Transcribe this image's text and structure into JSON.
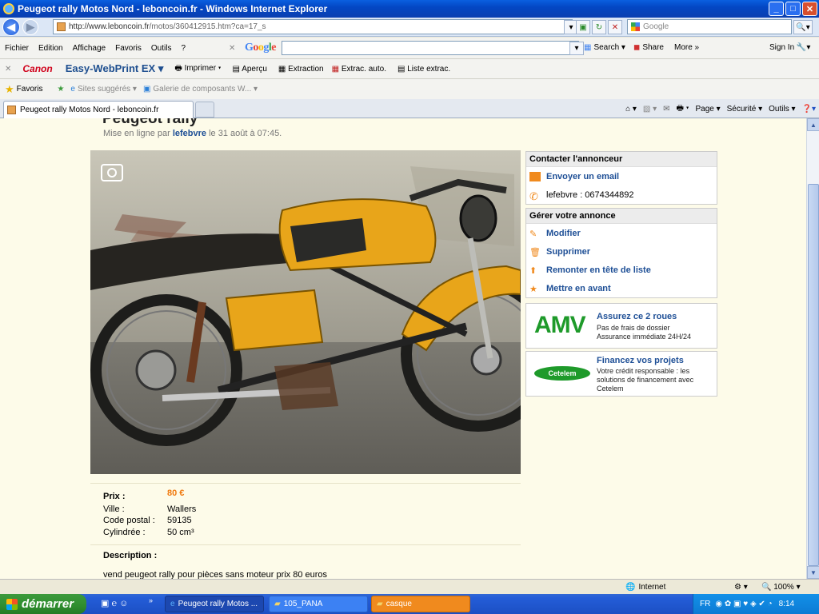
{
  "window": {
    "title": "Peugeot rally Motos Nord - leboncoin.fr - Windows Internet Explorer"
  },
  "address": {
    "url_host": "http://www.leboncoin.fr",
    "url_path": "/motos/360412915.htm?ca=17_s",
    "search_placeholder": "Google"
  },
  "menu": {
    "items": [
      "Fichier",
      "Edition",
      "Affichage",
      "Favoris",
      "Outils",
      "?"
    ],
    "google_label": "Google",
    "search": "Search",
    "share": "Share",
    "more": "More »",
    "signin": "Sign In"
  },
  "canonbar": {
    "canon": "Canon",
    "ewp": "Easy-WebPrint EX",
    "imprimer": "Imprimer",
    "apercu": "Aperçu",
    "extraction": "Extraction",
    "extrac_auto": "Extrac. auto.",
    "liste": "Liste extrac."
  },
  "favbar": {
    "favoris": "Favoris",
    "sites": "Sites suggérés",
    "galerie": "Galerie de composants W..."
  },
  "tabs": {
    "active": "Peugeot rally Motos Nord - leboncoin.fr",
    "page": "Page",
    "securite": "Sécurité",
    "outils": "Outils"
  },
  "ad": {
    "title": "Peugeot rally",
    "posted_prefix": "Mise en ligne par",
    "author": "lefebvre",
    "posted_suffix": "le 31 août à 07:45."
  },
  "contact": {
    "header": "Contacter l'annonceur",
    "email": "Envoyer un email",
    "phone": "lefebvre : 0674344892"
  },
  "manage": {
    "header": "Gérer votre annonce",
    "modifier": "Modifier",
    "supprimer": "Supprimer",
    "remonter": "Remonter en tête de liste",
    "mettre": "Mettre en avant"
  },
  "promo_amv": {
    "logo": "AMV",
    "title": "Assurez ce 2 roues",
    "line1": "Pas de frais de dossier",
    "line2": "Assurance immédiate 24H/24"
  },
  "promo_cetelem": {
    "logo": "Cetelem",
    "title": "Financez vos projets",
    "line1": "Votre crédit responsable : les",
    "line2": "solutions de financement avec",
    "line3": "Cetelem"
  },
  "details": {
    "prix_label": "Prix :",
    "prix_value": "80 €",
    "ville_label": "Ville :",
    "ville_value": "Wallers",
    "cp_label": "Code postal :",
    "cp_value": "59135",
    "cyl_label": "Cylindrée :",
    "cyl_value": "50 cm³",
    "desc_label": "Description :",
    "desc_text": "vend peugeot rally pour pièces sans moteur prix 80 euros"
  },
  "status": {
    "zone": "Internet",
    "zoom": "100%"
  },
  "taskbar": {
    "start": "démarrer",
    "task1": "Peugeot rally Motos ...",
    "task2": "105_PANA",
    "task3": "casque",
    "lang": "FR",
    "time": "8:14"
  }
}
